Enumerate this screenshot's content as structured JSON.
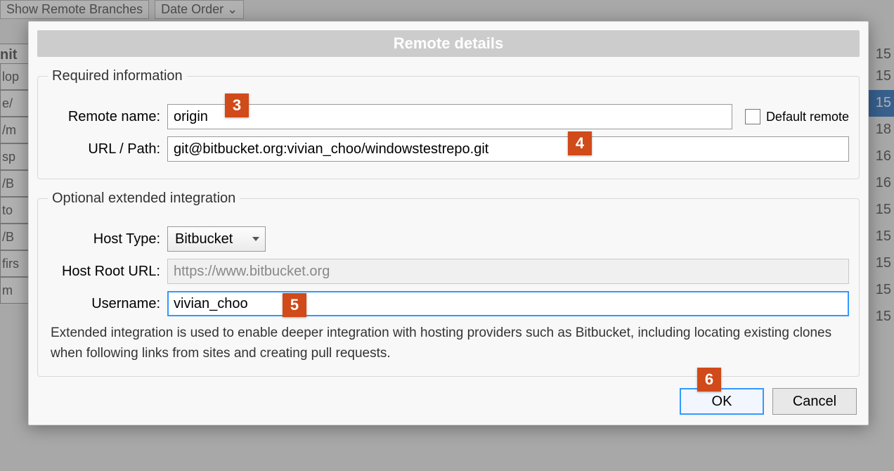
{
  "backdrop": {
    "toolbar_remote_branches": "Show Remote Branches",
    "toolbar_order": "Date Order",
    "header_left": "nit",
    "header_right": "15",
    "left_rows": [
      "lop",
      "e/",
      "/m",
      "sp",
      "/B",
      "to",
      "/B",
      "firs",
      "m"
    ],
    "right_rows": [
      "15",
      "15",
      "18",
      "16",
      "16",
      "15",
      "15",
      "15",
      "15",
      "15"
    ]
  },
  "dialog": {
    "title": "Remote details",
    "required_legend": "Required information",
    "optional_legend": "Optional extended integration",
    "remote_name_label": "Remote name:",
    "remote_name_value": "origin",
    "default_remote_label": "Default remote",
    "url_path_label": "URL / Path:",
    "url_path_value": "git@bitbucket.org:vivian_choo/windowstestrepo.git",
    "host_type_label": "Host Type:",
    "host_type_value": "Bitbucket",
    "host_root_label": "Host Root URL:",
    "host_root_value": "https://www.bitbucket.org",
    "username_label": "Username:",
    "username_value": "vivian_choo",
    "hint": "Extended integration is used to enable deeper integration with hosting providers such as Bitbucket, including locating existing clones when following links from sites and creating pull requests.",
    "ok": "OK",
    "cancel": "Cancel"
  },
  "badges": {
    "b3": "3",
    "b4": "4",
    "b5": "5",
    "b6": "6"
  }
}
